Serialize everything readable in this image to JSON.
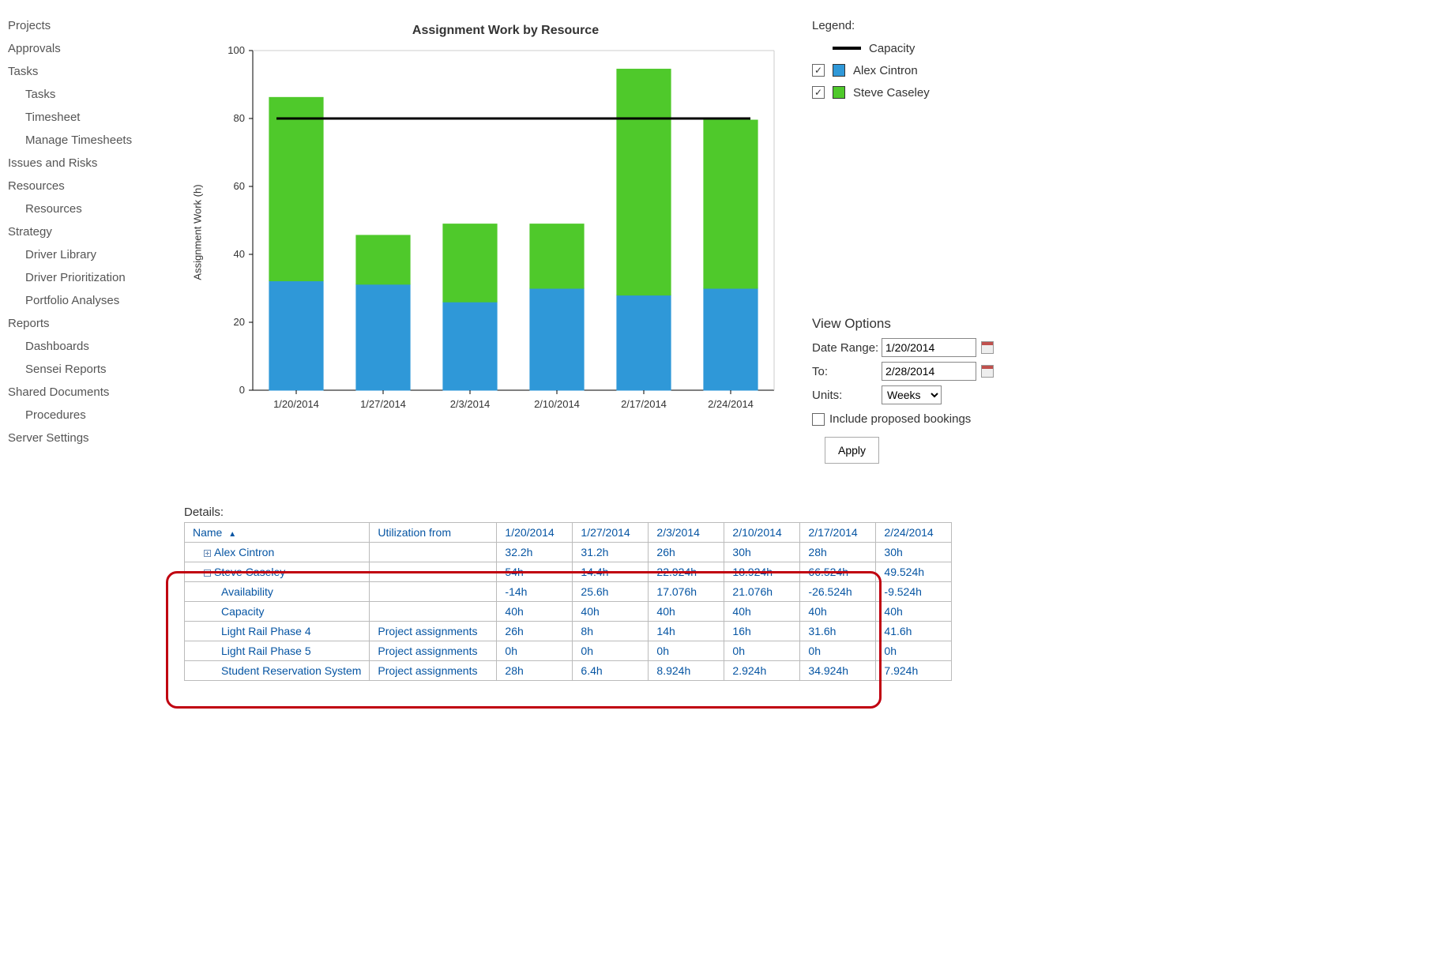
{
  "nav": [
    {
      "label": "Projects",
      "sub": false
    },
    {
      "label": "Approvals",
      "sub": false
    },
    {
      "label": "Tasks",
      "sub": false
    },
    {
      "label": "Tasks",
      "sub": true
    },
    {
      "label": "Timesheet",
      "sub": true
    },
    {
      "label": "Manage Timesheets",
      "sub": true
    },
    {
      "label": "Issues and Risks",
      "sub": false
    },
    {
      "label": "Resources",
      "sub": false
    },
    {
      "label": "Resources",
      "sub": true
    },
    {
      "label": "Strategy",
      "sub": false
    },
    {
      "label": "Driver Library",
      "sub": true
    },
    {
      "label": "Driver Prioritization",
      "sub": true
    },
    {
      "label": "Portfolio Analyses",
      "sub": true
    },
    {
      "label": "Reports",
      "sub": false
    },
    {
      "label": "Dashboards",
      "sub": true
    },
    {
      "label": "Sensei Reports",
      "sub": true
    },
    {
      "label": "Shared Documents",
      "sub": false
    },
    {
      "label": "Procedures",
      "sub": true
    },
    {
      "label": "Server Settings",
      "sub": false
    }
  ],
  "chart_title": "Assignment Work by Resource",
  "y_axis_label": "Assignment Work (h)",
  "chart_data": {
    "type": "bar",
    "stacked": true,
    "categories": [
      "1/20/2014",
      "1/27/2014",
      "2/3/2014",
      "2/10/2014",
      "2/17/2014",
      "2/24/2014"
    ],
    "series": [
      {
        "name": "Alex Cintron",
        "color": "#2f98d8",
        "values": [
          32.2,
          31.2,
          26,
          30,
          28,
          30
        ]
      },
      {
        "name": "Steve Caseley",
        "color": "#4fc92b",
        "values": [
          54,
          14.4,
          22.924,
          18.924,
          66.524,
          49.524
        ]
      }
    ],
    "capacity_line": 80,
    "ylim": [
      0,
      100
    ],
    "ytick": 20,
    "xlabel": "",
    "ylabel": "Assignment Work (h)",
    "title": "Assignment Work by Resource"
  },
  "legend": {
    "title": "Legend:",
    "capacity_label": "Capacity",
    "items": [
      {
        "label": "Alex Cintron",
        "color": "#2f98d8",
        "checked": true
      },
      {
        "label": "Steve Caseley",
        "color": "#4fc92b",
        "checked": true
      }
    ]
  },
  "view_options": {
    "title": "View Options",
    "date_range_label": "Date Range:",
    "date_from_value": "1/20/2014",
    "to_label": "To:",
    "date_to_value": "2/28/2014",
    "units_label": "Units:",
    "units_value": "Weeks",
    "include_proposed_label": "Include proposed bookings",
    "include_proposed_checked": false,
    "apply_label": "Apply"
  },
  "details": {
    "title": "Details:",
    "headers": {
      "name": "Name",
      "util": "Utilization from",
      "dates": [
        "1/20/2014",
        "1/27/2014",
        "2/3/2014",
        "2/10/2014",
        "2/17/2014",
        "2/24/2014"
      ]
    },
    "rows": [
      {
        "expand": "plus",
        "indent": 1,
        "name": "Alex Cintron",
        "util": "",
        "vals": [
          "32.2h",
          "31.2h",
          "26h",
          "30h",
          "28h",
          "30h"
        ]
      },
      {
        "expand": "minus",
        "indent": 1,
        "name": "Steve Caseley",
        "util": "",
        "vals": [
          "54h",
          "14.4h",
          "22.924h",
          "18.924h",
          "66.524h",
          "49.524h"
        ]
      },
      {
        "expand": "",
        "indent": 2,
        "name": "Availability",
        "util": "",
        "vals": [
          "-14h",
          "25.6h",
          "17.076h",
          "21.076h",
          "-26.524h",
          "-9.524h"
        ]
      },
      {
        "expand": "",
        "indent": 2,
        "name": "Capacity",
        "util": "",
        "vals": [
          "40h",
          "40h",
          "40h",
          "40h",
          "40h",
          "40h"
        ]
      },
      {
        "expand": "",
        "indent": 2,
        "name": "Light Rail Phase 4",
        "util": "Project assignments",
        "vals": [
          "26h",
          "8h",
          "14h",
          "16h",
          "31.6h",
          "41.6h"
        ]
      },
      {
        "expand": "",
        "indent": 2,
        "name": "Light Rail Phase 5",
        "util": "Project assignments",
        "vals": [
          "0h",
          "0h",
          "0h",
          "0h",
          "0h",
          "0h"
        ]
      },
      {
        "expand": "",
        "indent": 2,
        "name": "Student Reservation System",
        "util": "Project assignments",
        "vals": [
          "28h",
          "6.4h",
          "8.924h",
          "2.924h",
          "34.924h",
          "7.924h"
        ]
      }
    ]
  }
}
